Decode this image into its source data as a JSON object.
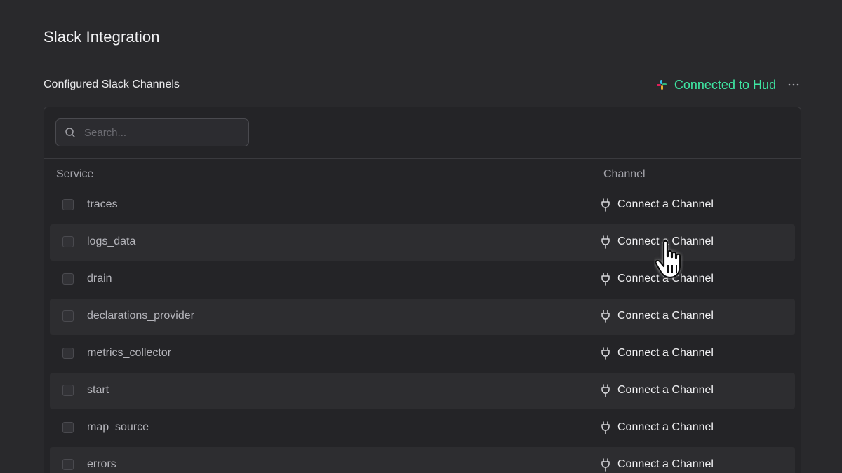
{
  "page": {
    "title": "Slack Integration"
  },
  "section": {
    "title": "Configured Slack Channels",
    "status_text": "Connected to Hud",
    "more_label": "···"
  },
  "search": {
    "placeholder": "Search...",
    "value": ""
  },
  "table": {
    "columns": {
      "service": "Service",
      "channel": "Channel"
    },
    "rows": [
      {
        "service": "traces",
        "channel": "Connect a Channel"
      },
      {
        "service": "logs_data",
        "channel": "Connect a Channel"
      },
      {
        "service": "drain",
        "channel": "Connect a Channel"
      },
      {
        "service": "declarations_provider",
        "channel": "Connect a Channel"
      },
      {
        "service": "metrics_collector",
        "channel": "Connect a Channel"
      },
      {
        "service": "start",
        "channel": "Connect a Channel"
      },
      {
        "service": "map_source",
        "channel": "Connect a Channel"
      },
      {
        "service": "errors",
        "channel": "Connect a Channel"
      }
    ]
  },
  "colors": {
    "background": "#29292c",
    "panel": "#242427",
    "accent_green": "#3ee7a3",
    "row_alt": "#2d2d30"
  },
  "icons": {
    "status": "slack-logo-icon",
    "more": "ellipsis-icon",
    "search": "search-icon",
    "channel": "plug-icon",
    "cursor": "hand-pointer-icon"
  }
}
